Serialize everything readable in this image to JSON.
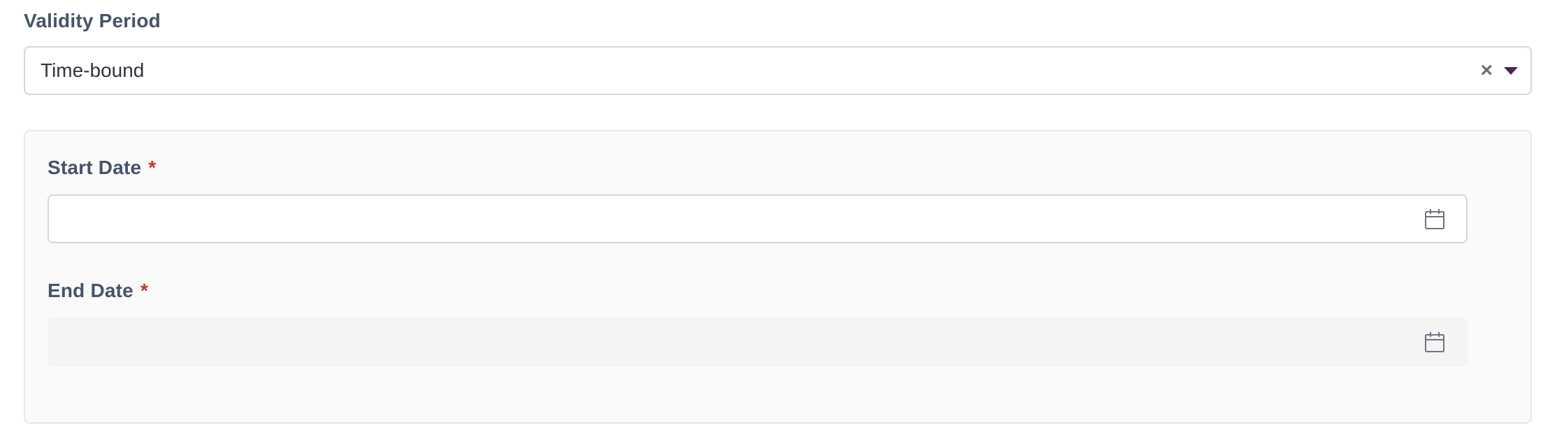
{
  "validity": {
    "label": "Validity Period",
    "value": "Time-bound",
    "clear_glyph": "×",
    "caret_icon": "caret-down-icon",
    "caret_color": "#4a2550"
  },
  "start_date": {
    "label": "Start Date",
    "required_mark": "*",
    "value": "",
    "icon": "calendar-icon"
  },
  "end_date": {
    "label": "End Date",
    "required_mark": "*",
    "value": "",
    "disabled": true,
    "icon": "calendar-icon"
  },
  "colors": {
    "label": "#46536a",
    "required": "#c0392b",
    "border": "#d3d6e0"
  }
}
